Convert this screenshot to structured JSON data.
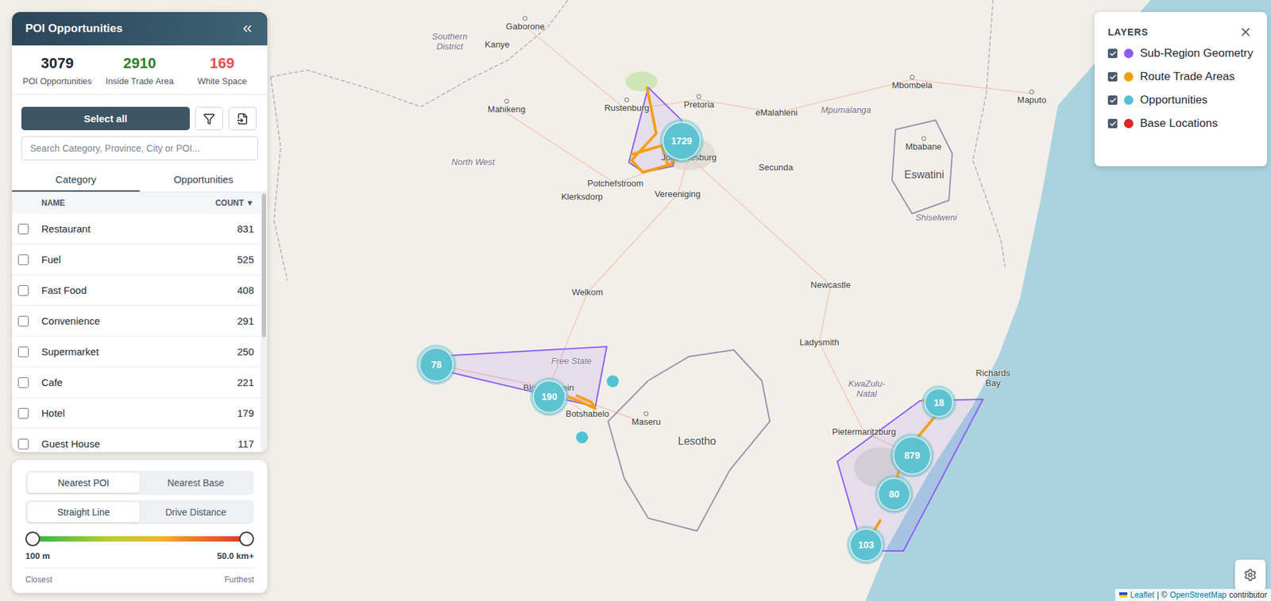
{
  "panel": {
    "title": "POI Opportunities",
    "stats": [
      {
        "value": "3079",
        "label": "POI Opportunities",
        "color": "#1f2933"
      },
      {
        "value": "2910",
        "label": "Inside Trade Area",
        "color": "#2e7d32"
      },
      {
        "value": "169",
        "label": "White Space",
        "color": "#e05252"
      }
    ],
    "select_all": "Select all",
    "search": {
      "placeholder": "Search Category, Province, City or POI..."
    },
    "tabs": [
      {
        "label": "Category",
        "selected": true
      },
      {
        "label": "Opportunities",
        "selected": false
      }
    ],
    "table": {
      "columns": [
        "NAME",
        "COUNT ▼"
      ],
      "rows": [
        {
          "name": "Restaurant",
          "count": "831",
          "checked": false
        },
        {
          "name": "Fuel",
          "count": "525",
          "checked": false
        },
        {
          "name": "Fast Food",
          "count": "408",
          "checked": false
        },
        {
          "name": "Convenience",
          "count": "291",
          "checked": false
        },
        {
          "name": "Supermarket",
          "count": "250",
          "checked": false
        },
        {
          "name": "Cafe",
          "count": "221",
          "checked": false
        },
        {
          "name": "Hotel",
          "count": "179",
          "checked": false
        },
        {
          "name": "Guest House",
          "count": "117",
          "checked": false
        }
      ]
    }
  },
  "distance": {
    "targets": [
      {
        "label": "Nearest POI",
        "selected": true
      },
      {
        "label": "Nearest Base",
        "selected": false
      }
    ],
    "metrics": [
      {
        "label": "Straight Line",
        "selected": true
      },
      {
        "label": "Drive Distance",
        "selected": false
      }
    ],
    "slider": {
      "low": 0,
      "high": 1,
      "min_label": "100 m",
      "max_label": "50.0 km+",
      "left_caption": "Closest",
      "right_caption": "Furthest"
    }
  },
  "layers": {
    "title": "LAYERS",
    "items": [
      {
        "label": "Sub-Region Geometry",
        "checked": true,
        "color": "#8b5cf6"
      },
      {
        "label": "Route Trade Areas",
        "checked": true,
        "color": "#f59e0b"
      },
      {
        "label": "Opportunities",
        "checked": true,
        "color": "#4fc3d4"
      },
      {
        "label": "Base Locations",
        "checked": true,
        "color": "#dc2626"
      }
    ]
  },
  "map": {
    "places": [
      {
        "name": "Gaborone",
        "kind": "city"
      },
      {
        "name": "Southern District",
        "kind": "region"
      },
      {
        "name": "Kanye",
        "kind": "town"
      },
      {
        "name": "Mahikeng",
        "kind": "city"
      },
      {
        "name": "Rustenburg",
        "kind": "city"
      },
      {
        "name": "Pretoria",
        "kind": "city"
      },
      {
        "name": "eMalahleni",
        "kind": "town"
      },
      {
        "name": "Mpumalanga",
        "kind": "region"
      },
      {
        "name": "Mbombela",
        "kind": "city"
      },
      {
        "name": "Maputo",
        "kind": "city"
      },
      {
        "name": "North West",
        "kind": "region"
      },
      {
        "name": "Johannesburg",
        "kind": "town"
      },
      {
        "name": "Secunda",
        "kind": "town"
      },
      {
        "name": "Mbabane",
        "kind": "city"
      },
      {
        "name": "Eswatini",
        "kind": "country"
      },
      {
        "name": "Potchefstroom",
        "kind": "town"
      },
      {
        "name": "Klerksdorp",
        "kind": "town"
      },
      {
        "name": "Vereeniging",
        "kind": "town"
      },
      {
        "name": "Shiselweni",
        "kind": "region"
      },
      {
        "name": "Welkom",
        "kind": "town"
      },
      {
        "name": "Newcastle",
        "kind": "town"
      },
      {
        "name": "Ladysmith",
        "kind": "town"
      },
      {
        "name": "Free State",
        "kind": "region"
      },
      {
        "name": "Bloemfontein",
        "kind": "town"
      },
      {
        "name": "Botshabelo",
        "kind": "town"
      },
      {
        "name": "Maseru",
        "kind": "city"
      },
      {
        "name": "Lesotho",
        "kind": "country"
      },
      {
        "name": "KwaZulu-Natal",
        "kind": "region"
      },
      {
        "name": "Richards Bay",
        "kind": "town"
      },
      {
        "name": "Pietermaritzburg",
        "kind": "town"
      }
    ],
    "clusters": [
      {
        "count": "1729"
      },
      {
        "count": "78"
      },
      {
        "count": "190"
      },
      {
        "count": "18"
      },
      {
        "count": "879"
      },
      {
        "count": "80"
      },
      {
        "count": "103"
      }
    ],
    "attribution": [
      {
        "text": "Leaflet",
        "link": true
      },
      {
        "text": "| ©",
        "link": false
      },
      {
        "text": "OpenStreetMap",
        "link": true
      },
      {
        "text": "contributor",
        "link": false
      }
    ]
  }
}
